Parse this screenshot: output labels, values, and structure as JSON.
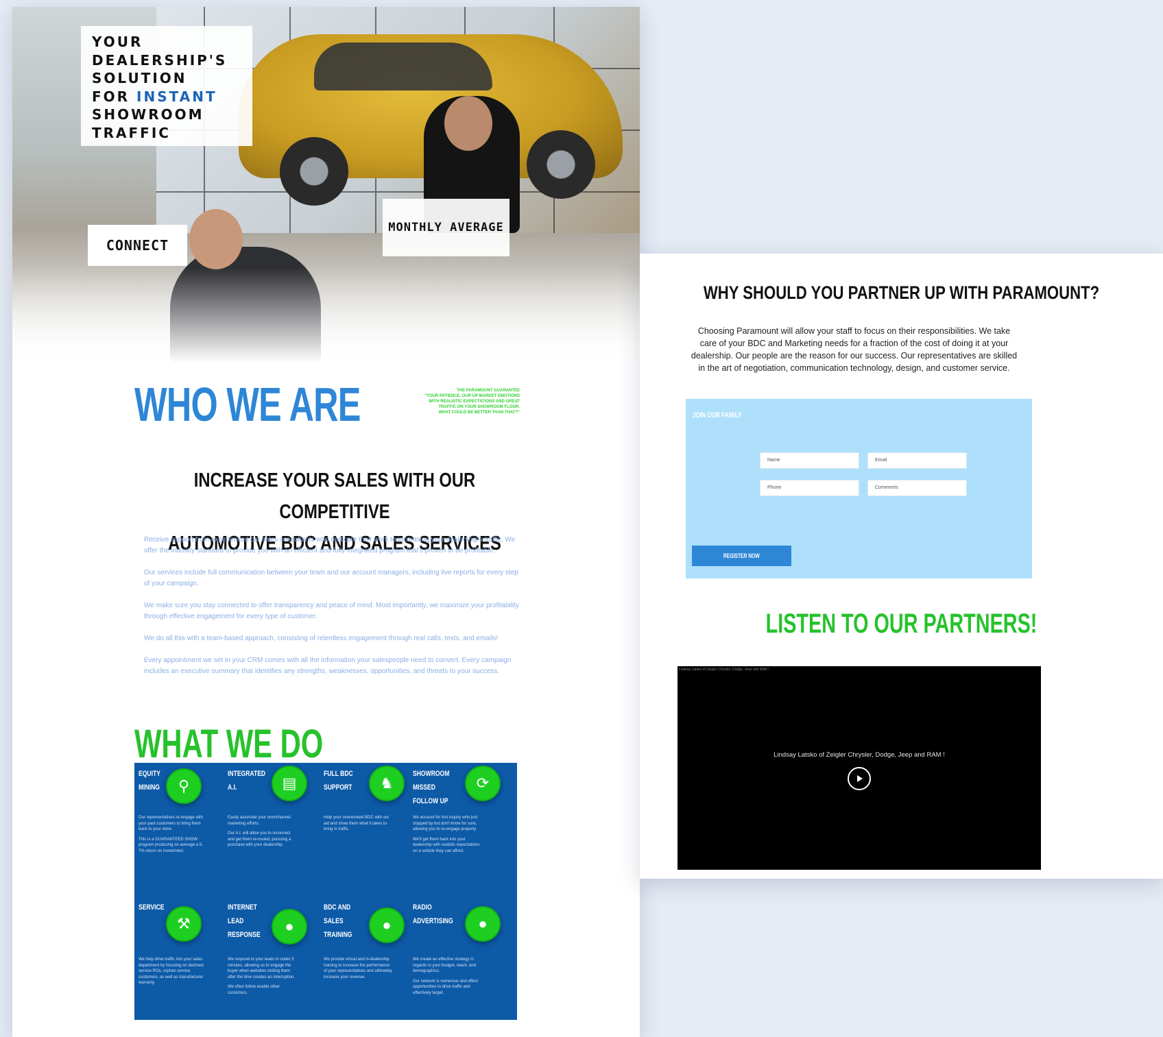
{
  "hero": {
    "title_lines": [
      "YOUR",
      "DEALERSHIP'S",
      "SOLUTION"
    ],
    "title_for": "FOR",
    "title_accent": "INSTANT",
    "title_tail": [
      "SHOWROOM",
      "TRAFFIC"
    ],
    "connect_label": "CONNECT",
    "monthly_label": "MONTHLY AVERAGE",
    "accent_color": "#1b64b8"
  },
  "who": {
    "title": "WHO WE ARE",
    "quote_lines": [
      "THE PARAMOUNT GUARANTEE",
      "\"YOUR PATIENCE, OUR UP MARKET EMOTIONS",
      "WITH REALISTIC EXPECTATIONS AND GREAT",
      "TRAFFIC ON YOUR SHOWROOM FLOOR.",
      "WHAT COULD BE BETTER THAN THAT?\""
    ],
    "headline_lines": [
      "INCREASE YOUR SALES WITH OUR COMPETITIVE",
      "AUTOMOTIVE BDC AND SALES SERVICES"
    ],
    "paragraphs": [
      "Receive support from experienced car sales consultants who dedicate their work to increasing your dealership's traffic. We offer the industry standard to provide you with an efficient and fully integrated program that's proven to be profitable.",
      "Our services include full communication between your team and our account managers, including live reports for every step of your campaign.",
      "We make sure you stay connected to offer transparency and peace of mind. Most importantly, we maximize your profitability through effective engagement for every type of customer.",
      "We do all this with a team-based approach, consisting of relentless engagement through real calls, texts, and emails!",
      "Every appointment we set in your CRM comes with all the information your salespeople need to convert. Every campaign includes an executive summary that identifies any strengths, weaknesses, opportunities, and threats to your success."
    ]
  },
  "what": {
    "title": "WHAT WE DO",
    "services": [
      {
        "title": "EQUITY MINING",
        "icon": "magnifier-icon",
        "text": [
          "Our representatives re-engage with your past customers to bring them back to your store.",
          "This is a GUARANTEED SHOW program producing on average a 5-7% return on investment."
        ]
      },
      {
        "title": "INTEGRATED A.I.",
        "icon": "monitor-icon",
        "text": [
          "Easily automate your omnichannel marketing efforts.",
          "Our A.I. will allow you to reconnect and get them re-routed, pursuing a purchase with your dealership."
        ]
      },
      {
        "title": "FULL BDC SUPPORT",
        "icon": "team-icon",
        "text": [
          "Help your overworked BDC with our aid and show them what it takes to bring in traffic."
        ]
      },
      {
        "title": "SHOWROOM MISSED FOLLOW UP",
        "icon": "refresh-icon",
        "text": [
          "We account for lost inquiry who just stopped by but don't know for sure, allowing you to re-engage properly.",
          "We'll get them back into your dealership with realistic expectations on a vehicle they can afford."
        ]
      },
      {
        "title": "SERVICE",
        "icon": "wrench-icon",
        "text": [
          "We help drive traffic into your sales department by focusing on declined service ROs, orphan service customers, as well as manufacturer warranty."
        ]
      },
      {
        "title": "INTERNET LEAD RESPONSE",
        "icon": "internet-icon",
        "text": [
          "We respond to your leads in under 5 minutes, allowing us to engage the buyer when websites visiting them after the time creates an interruption.",
          "We often follow enable other customers."
        ]
      },
      {
        "title": "BDC AND SALES TRAINING",
        "icon": "training-icon",
        "text": [
          "We provide virtual and in-dealership training to increase the performance of your representatives and ultimately increase your revenue."
        ]
      },
      {
        "title": "RADIO ADVERTISING",
        "icon": "radio-icon",
        "text": [
          "We create an effective strategy in regards to your budget, reach, and demographics.",
          "Our network is numerous and offers opportunities to drive traffic and effectively target."
        ]
      }
    ]
  },
  "partner": {
    "title": "WHY SHOULD YOU PARTNER UP WITH PARAMOUNT?",
    "text_lines": [
      "Choosing Paramount will allow your staff to focus on their responsibilities. We take",
      "care of your BDC and Marketing needs for a fraction of the cost of doing it at your",
      "dealership. Our people are the reason for our success. Our representatives are skilled",
      "in the art of negotiation, communication technology, design, and customer service."
    ],
    "form": {
      "heading": "JOIN OUR FAMILY",
      "name_placeholder": "Name",
      "email_placeholder": "Email",
      "phone_placeholder": "Phone",
      "comments_placeholder": "Comments",
      "submit_label": "REGISTER NOW"
    },
    "listen_title": "LISTEN TO OUR PARTNERS!",
    "video": {
      "alt_text": "Lindsay Latsko of Zeigler Chrysler, Dodge, Jeep and RAM !",
      "caption": "Lindsay Latsko of Zeigler Chrysler, Dodge, Jeep and RAM !"
    }
  },
  "colors": {
    "page_bg": "#e6ecf5",
    "blue_heading": "#2e86d6",
    "green_heading": "#26c22c",
    "services_bg": "#0d5aa7",
    "form_bg": "#aee0fb"
  }
}
